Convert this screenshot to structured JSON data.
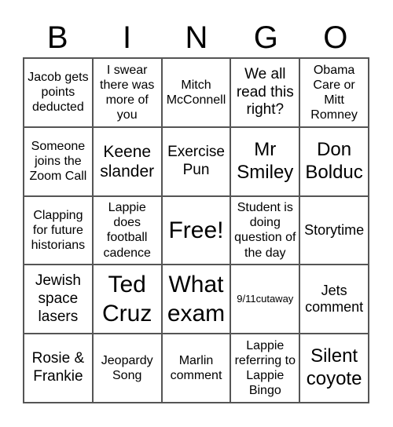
{
  "header": {
    "letters": [
      "B",
      "I",
      "N",
      "G",
      "O"
    ]
  },
  "cells": [
    [
      "Jacob gets points deducted",
      "I swear there was more of you",
      "Mitch McConnell",
      "We all read this right?",
      "Obama Care or Mitt Romney"
    ],
    [
      "Someone joins the Zoom Call",
      "Keene slander",
      "Exercise Pun",
      "Mr Smiley",
      "Don Bolduc"
    ],
    [
      "Clapping for future historians",
      "Lappie does football cadence",
      "Free!",
      "Student is doing question of the day",
      "Storytime"
    ],
    [
      "Jewish space lasers",
      "Ted Cruz",
      "What exam",
      "9/11cutaway",
      "Jets comment"
    ],
    [
      "Rosie & Frankie",
      "Jeopardy Song",
      "Marlin comment",
      "Lappie referring to Lappie Bingo",
      "Silent coyote"
    ]
  ]
}
